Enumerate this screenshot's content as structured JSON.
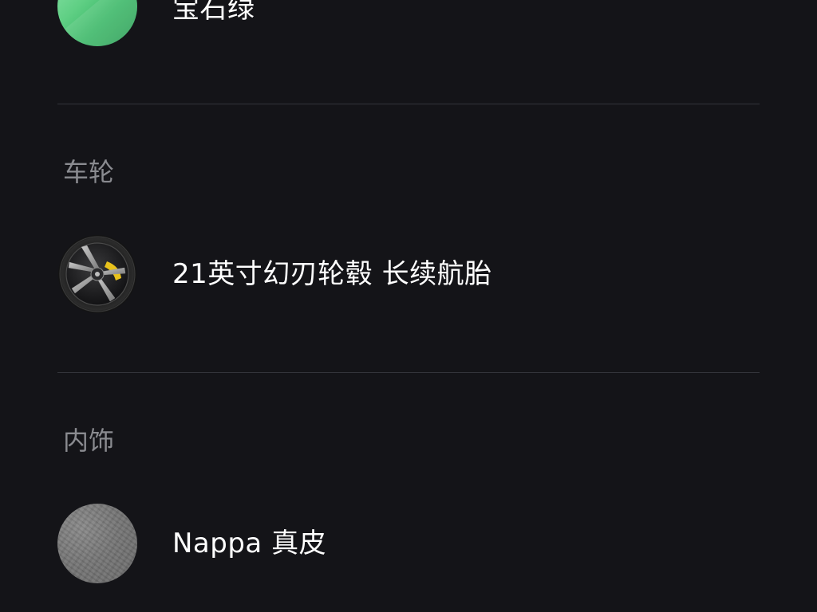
{
  "color_option": {
    "label": "宝石绿",
    "swatch_color": "#4cc476"
  },
  "sections": {
    "wheels": {
      "title": "车轮",
      "option_label": "21英寸幻刃轮毂 长续航胎",
      "icon": "wheel-icon",
      "caliper_color": "#e8c21c"
    },
    "interior": {
      "title": "内饰",
      "option_label": "Nappa 真皮",
      "swatch_color": "#727272"
    }
  },
  "colors": {
    "background": "#141418",
    "divider": "#33343a",
    "section_title": "#8a8b90",
    "text": "#ffffff"
  }
}
